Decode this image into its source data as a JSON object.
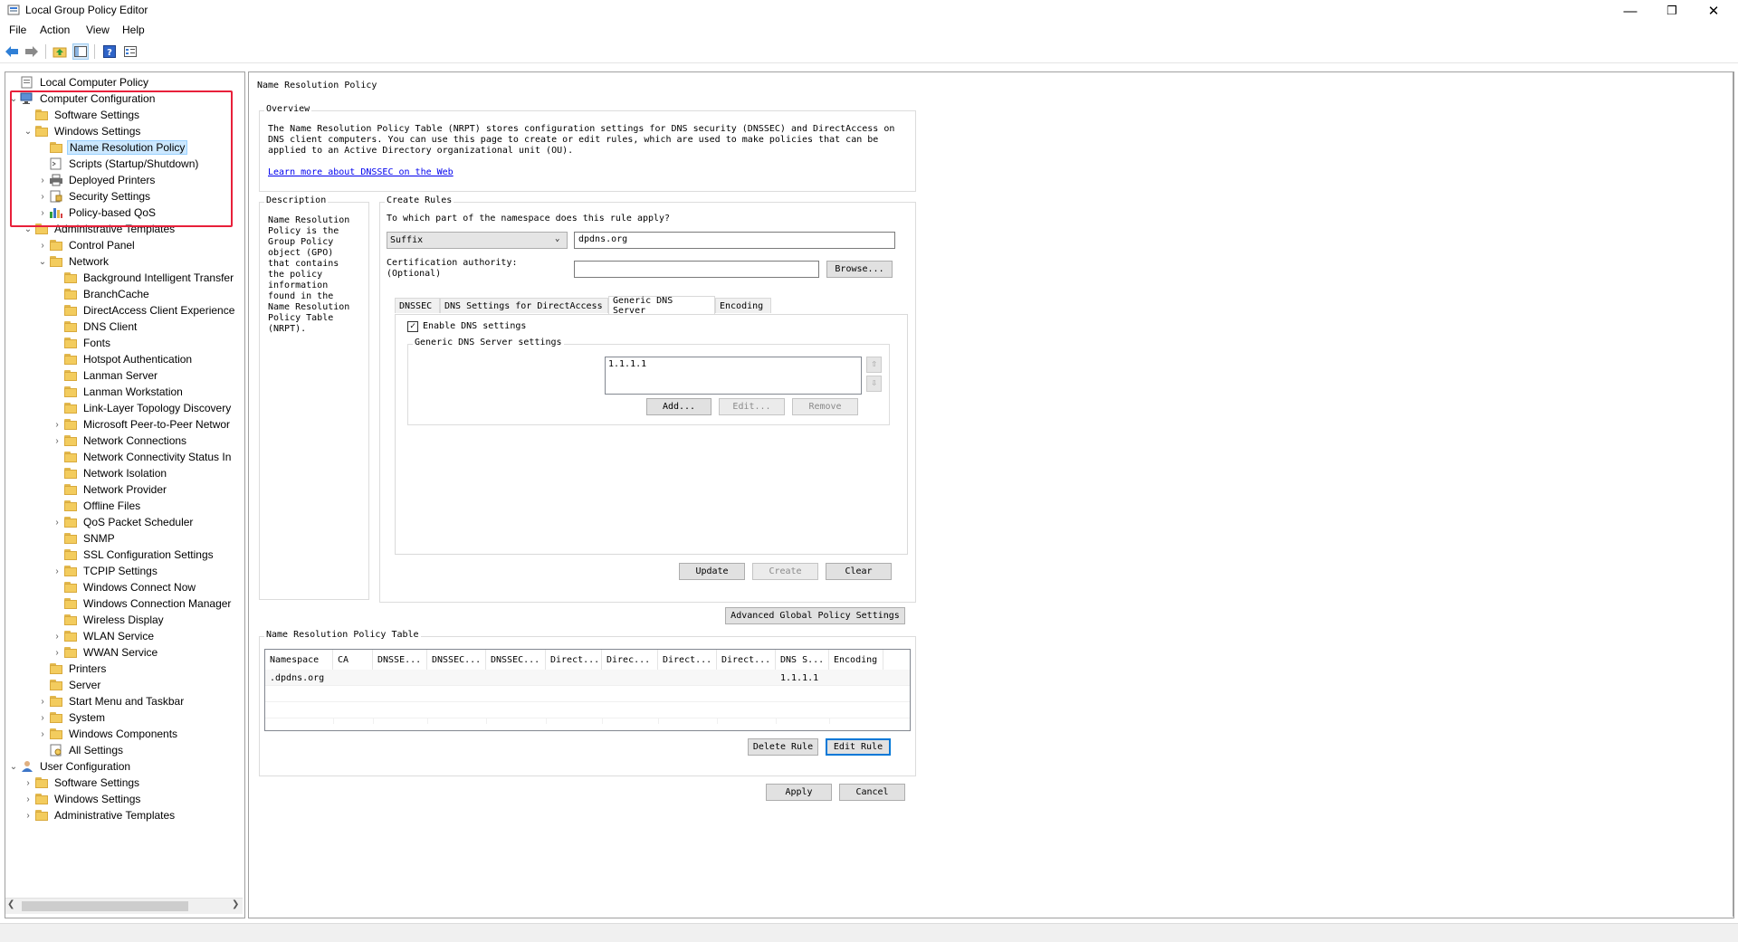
{
  "window": {
    "title": "Local Group Policy Editor",
    "minimize": "—",
    "restore": "❐",
    "close": "✕"
  },
  "menu": [
    "File",
    "Action",
    "View",
    "Help"
  ],
  "tree": {
    "root": "Local Computer Policy",
    "computer_configuration": "Computer Configuration",
    "software_settings": "Software Settings",
    "windows_settings": "Windows Settings",
    "name_resolution_policy": "Name Resolution Policy",
    "scripts": "Scripts (Startup/Shutdown)",
    "deployed_printers": "Deployed Printers",
    "security_settings": "Security Settings",
    "policy_qos": "Policy-based QoS",
    "administrative_templates": "Administrative Templates",
    "control_panel": "Control Panel",
    "network": "Network",
    "network_children": [
      "Background Intelligent Transfer",
      "BranchCache",
      "DirectAccess Client Experience",
      "DNS Client",
      "Fonts",
      "Hotspot Authentication",
      "Lanman Server",
      "Lanman Workstation",
      "Link-Layer Topology Discovery",
      "Microsoft Peer-to-Peer Networ",
      "Network Connections",
      "Network Connectivity Status In",
      "Network Isolation",
      "Network Provider",
      "Offline Files",
      "QoS Packet Scheduler",
      "SNMP",
      "SSL Configuration Settings",
      "TCPIP Settings",
      "Windows Connect Now",
      "Windows Connection Manager",
      "Wireless Display",
      "WLAN Service",
      "WWAN Service"
    ],
    "printers": "Printers",
    "server": "Server",
    "start_menu": "Start Menu and Taskbar",
    "system": "System",
    "windows_components": "Windows Components",
    "all_settings": "All Settings",
    "user_configuration": "User Configuration",
    "user_software_settings": "Software Settings",
    "user_windows_settings": "Windows Settings",
    "user_administrative_templates": "Administrative Templates"
  },
  "content": {
    "page_title": "Name Resolution Policy",
    "overview": {
      "title": "Overview",
      "text": "The Name Resolution Policy Table (NRPT) stores configuration settings for DNS security (DNSSEC) and DirectAccess on DNS client computers. You can use this page to create or edit rules, which are used to make policies that can be applied to an Active Directory organizational unit (OU).",
      "link": "Learn more about DNSSEC on the Web"
    },
    "description": {
      "title": "Description",
      "text": "Name Resolution Policy is the Group Policy object (GPO) that contains the policy information found in the Name Resolution Policy Table (NRPT)."
    },
    "create_rules": {
      "title": "Create Rules",
      "question": "To which part of the namespace does this rule apply?",
      "scope_value": "Suffix",
      "namespace_value": "dpdns.org",
      "cert_label_1": "Certification authority:",
      "cert_label_2": "(Optional)",
      "cert_value": "",
      "browse": "Browse...",
      "tabs": [
        "DNSSEC",
        "DNS Settings for DirectAccess",
        "Generic DNS Server",
        "Encoding"
      ],
      "enable_dns": "Enable DNS settings",
      "generic_group": "Generic DNS Server settings",
      "servers": [
        "1.1.1.1"
      ],
      "add": "Add...",
      "edit": "Edit...",
      "remove": "Remove",
      "update": "Update",
      "create": "Create",
      "clear": "Clear"
    },
    "advanced": "Advanced Global Policy Settings",
    "table": {
      "title": "Name Resolution Policy Table",
      "columns": [
        "Namespace",
        "CA",
        "DNSSE...",
        "DNSSEC...",
        "DNSSEC...",
        "Direct...",
        "Direc...",
        "Direct...",
        "Direct...",
        "DNS S...",
        "Encoding"
      ],
      "rows": [
        [
          ".dpdns.org",
          "",
          "",
          "",
          "",
          "",
          "",
          "",
          "",
          "1.1.1.1",
          ""
        ]
      ],
      "delete_rule": "Delete Rule",
      "edit_rule": "Edit Rule"
    },
    "apply": "Apply",
    "cancel": "Cancel"
  },
  "colors": {
    "highlight_box": "#e8203a",
    "selection": "#cce8ff",
    "link": "#0000ee",
    "default_button_border": "#0078d7"
  }
}
